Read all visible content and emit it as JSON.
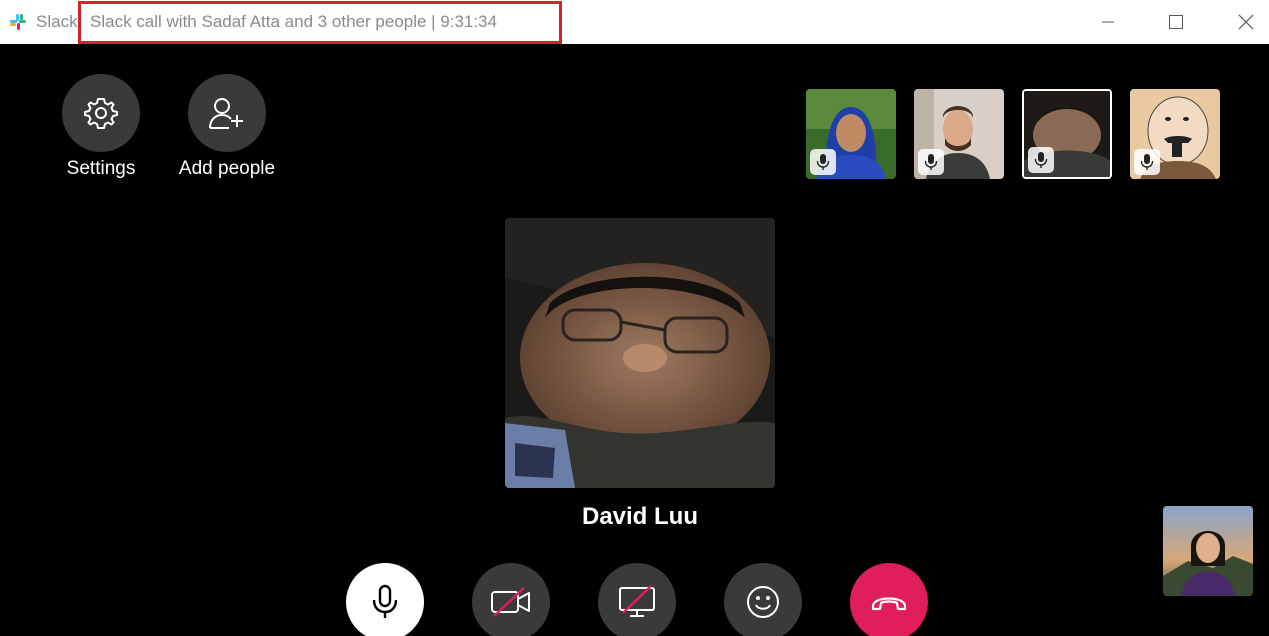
{
  "window": {
    "app_name": "Slack",
    "title": "Slack call with Sadaf Atta and 3 other people | 9:31:34"
  },
  "controls": {
    "settings_label": "Settings",
    "add_people_label": "Add people"
  },
  "participants": [
    {
      "icon": "avatar-woman-hijab",
      "mic": "mic-icon",
      "active": false
    },
    {
      "icon": "avatar-man-glasses",
      "mic": "mic-icon",
      "active": false
    },
    {
      "icon": "avatar-david-luu",
      "mic": "mic-icon",
      "active": true
    },
    {
      "icon": "avatar-cartoon",
      "mic": "mic-icon",
      "active": false
    }
  ],
  "main_speaker": {
    "name": "David Luu"
  },
  "bottom_bar": {
    "buttons": [
      "mic-icon",
      "video-off-icon",
      "screen-share-off-icon",
      "emoji-icon",
      "hang-up-icon"
    ]
  },
  "colors": {
    "background": "#000000",
    "hangup": "#e01e5a",
    "control": "#3a3a3a",
    "highlight": "#d6222a"
  }
}
